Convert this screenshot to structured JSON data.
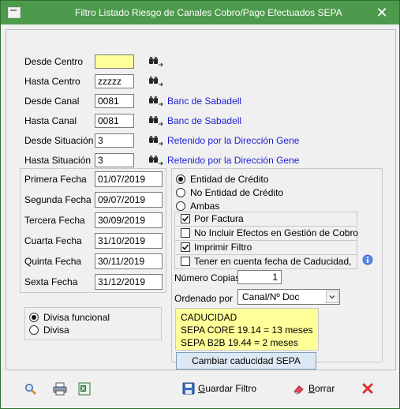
{
  "window": {
    "title": "Filtro Listado Riesgo de Canales Cobro/Pago Efectuados SEPA",
    "close_symbol": "✕"
  },
  "rows": [
    {
      "label": "Desde Centro",
      "value": "",
      "desc": ""
    },
    {
      "label": "Hasta Centro",
      "value": "zzzzz",
      "desc": ""
    },
    {
      "label": "Desde Canal",
      "value": "0081",
      "desc": "Banc de Sabadell"
    },
    {
      "label": "Hasta Canal",
      "value": "0081",
      "desc": "Banc de Sabadell"
    },
    {
      "label": "Desde Situación",
      "value": "3",
      "desc": "Retenido por la Dirección Gene"
    },
    {
      "label": "Hasta Situación",
      "value": "3",
      "desc": "Retenido por la Dirección Gene"
    }
  ],
  "dates": [
    {
      "label": "Primera Fecha",
      "value": "01/07/2019"
    },
    {
      "label": "Segunda Fecha",
      "value": "09/07/2019"
    },
    {
      "label": "Tercera Fecha",
      "value": "30/09/2019"
    },
    {
      "label": "Cuarta Fecha",
      "value": "31/10/2019"
    },
    {
      "label": "Quinta Fecha",
      "value": "30/11/2019"
    },
    {
      "label": "Sexta Fecha",
      "value": "31/12/2019"
    }
  ],
  "entity_options": [
    {
      "label": "Entidad de Crédito",
      "selected": true
    },
    {
      "label": "No Entidad de Crédito",
      "selected": false
    },
    {
      "label": "Ambas",
      "selected": false
    }
  ],
  "checkboxes": [
    {
      "label": "Por Factura",
      "checked": true
    },
    {
      "label": "No Incluir Efectos en Gestión de Cobro",
      "checked": false
    },
    {
      "label": "Imprimir Filtro",
      "checked": true
    },
    {
      "label": "Tener en cuenta fecha de Caducidad,",
      "checked": false
    }
  ],
  "copies": {
    "label": "Número Copias",
    "value": "1"
  },
  "order": {
    "label": "Ordenado por",
    "value": "Canal/Nº Doc"
  },
  "currency_options": [
    {
      "label": "Divisa funcional",
      "selected": true
    },
    {
      "label": "Divisa",
      "selected": false
    }
  ],
  "caducidad": {
    "line1": "CADUCIDAD",
    "line2": "SEPA CORE 19.14 = 13 meses",
    "line3": "SEPA B2B 19.44 = 2 meses"
  },
  "buttons": {
    "change_expiry": "Cambiar caducidad SEPA",
    "save_filter_pre": "",
    "save_filter_u": "G",
    "save_filter_post": "uardar Filtro",
    "delete_u": "B",
    "delete_post": "orrar"
  },
  "colors": {
    "titlebar": "#4d9a4d",
    "link": "#1f1fd6",
    "highlight_yellow": "#ffff99",
    "close_red": "#e03030"
  }
}
